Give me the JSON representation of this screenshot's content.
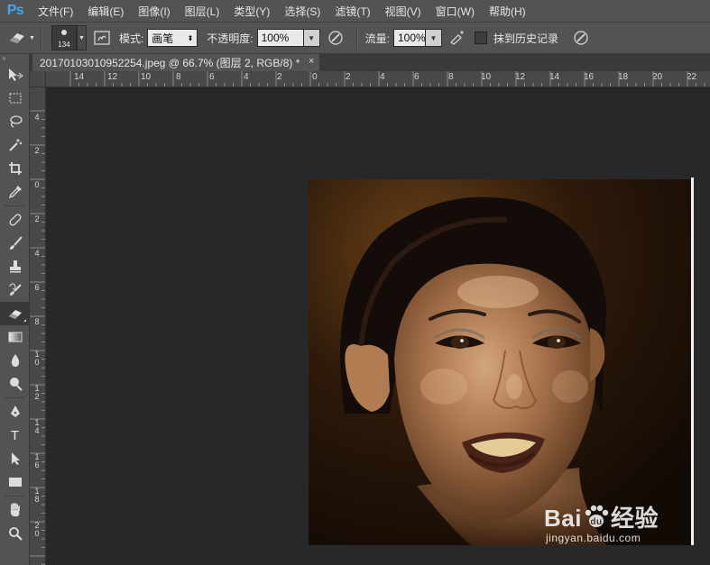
{
  "app": {
    "logo": "Ps"
  },
  "menu": [
    "文件(F)",
    "编辑(E)",
    "图像(I)",
    "图层(L)",
    "类型(Y)",
    "选择(S)",
    "滤镜(T)",
    "视图(V)",
    "窗口(W)",
    "帮助(H)"
  ],
  "options": {
    "brush_size": "134",
    "mode_label": "模式:",
    "mode_value": "画笔",
    "opacity_label": "不透明度:",
    "opacity_value": "100%",
    "flow_label": "流量:",
    "flow_value": "100%",
    "history_label": "抹到历史记录",
    "history_checked": false
  },
  "tools": [
    "move-tool",
    "marquee-tool",
    "lasso-tool",
    "magic-wand-tool",
    "crop-tool",
    "eyedropper-tool",
    "healing-brush-tool",
    "brush-tool",
    "clone-stamp-tool",
    "history-brush-tool",
    "eraser-tool",
    "gradient-tool",
    "blur-tool",
    "dodge-tool",
    "pen-tool",
    "type-tool",
    "path-selection-tool",
    "rectangle-tool",
    "hand-tool",
    "zoom-tool"
  ],
  "active_tool": "eraser-tool",
  "document": {
    "tab_title": "20170103010952254.jpeg @ 66.7% (图层 2, RGB/8) *",
    "close_glyph": "×"
  },
  "rulers": {
    "top": [
      "14",
      "12",
      "10",
      "8",
      "6",
      "4",
      "2",
      "0",
      "2",
      "4",
      "6",
      "8",
      "10",
      "12",
      "14",
      "16",
      "18",
      "20",
      "22"
    ],
    "left": [
      "4",
      "2",
      "0",
      "2",
      "4",
      "6",
      "8",
      "10",
      "12",
      "14",
      "16",
      "18",
      "20"
    ]
  },
  "watermark": {
    "brand": "Bai",
    "brand2": "经验",
    "url": "jingyan.baidu.com"
  },
  "colors": {
    "accent": "#3ea6f2",
    "panel": "#535353",
    "canvas_bg": "#282828"
  }
}
